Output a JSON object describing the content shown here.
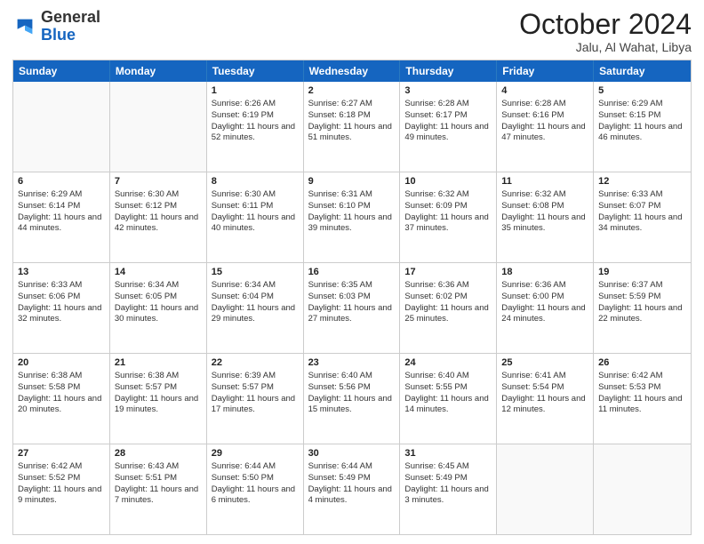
{
  "header": {
    "logo_general": "General",
    "logo_blue": "Blue",
    "month_title": "October 2024",
    "location": "Jalu, Al Wahat, Libya"
  },
  "weekdays": [
    "Sunday",
    "Monday",
    "Tuesday",
    "Wednesday",
    "Thursday",
    "Friday",
    "Saturday"
  ],
  "rows": [
    [
      {
        "day": "",
        "sunrise": "",
        "sunset": "",
        "daylight": ""
      },
      {
        "day": "",
        "sunrise": "",
        "sunset": "",
        "daylight": ""
      },
      {
        "day": "1",
        "sunrise": "Sunrise: 6:26 AM",
        "sunset": "Sunset: 6:19 PM",
        "daylight": "Daylight: 11 hours and 52 minutes."
      },
      {
        "day": "2",
        "sunrise": "Sunrise: 6:27 AM",
        "sunset": "Sunset: 6:18 PM",
        "daylight": "Daylight: 11 hours and 51 minutes."
      },
      {
        "day": "3",
        "sunrise": "Sunrise: 6:28 AM",
        "sunset": "Sunset: 6:17 PM",
        "daylight": "Daylight: 11 hours and 49 minutes."
      },
      {
        "day": "4",
        "sunrise": "Sunrise: 6:28 AM",
        "sunset": "Sunset: 6:16 PM",
        "daylight": "Daylight: 11 hours and 47 minutes."
      },
      {
        "day": "5",
        "sunrise": "Sunrise: 6:29 AM",
        "sunset": "Sunset: 6:15 PM",
        "daylight": "Daylight: 11 hours and 46 minutes."
      }
    ],
    [
      {
        "day": "6",
        "sunrise": "Sunrise: 6:29 AM",
        "sunset": "Sunset: 6:14 PM",
        "daylight": "Daylight: 11 hours and 44 minutes."
      },
      {
        "day": "7",
        "sunrise": "Sunrise: 6:30 AM",
        "sunset": "Sunset: 6:12 PM",
        "daylight": "Daylight: 11 hours and 42 minutes."
      },
      {
        "day": "8",
        "sunrise": "Sunrise: 6:30 AM",
        "sunset": "Sunset: 6:11 PM",
        "daylight": "Daylight: 11 hours and 40 minutes."
      },
      {
        "day": "9",
        "sunrise": "Sunrise: 6:31 AM",
        "sunset": "Sunset: 6:10 PM",
        "daylight": "Daylight: 11 hours and 39 minutes."
      },
      {
        "day": "10",
        "sunrise": "Sunrise: 6:32 AM",
        "sunset": "Sunset: 6:09 PM",
        "daylight": "Daylight: 11 hours and 37 minutes."
      },
      {
        "day": "11",
        "sunrise": "Sunrise: 6:32 AM",
        "sunset": "Sunset: 6:08 PM",
        "daylight": "Daylight: 11 hours and 35 minutes."
      },
      {
        "day": "12",
        "sunrise": "Sunrise: 6:33 AM",
        "sunset": "Sunset: 6:07 PM",
        "daylight": "Daylight: 11 hours and 34 minutes."
      }
    ],
    [
      {
        "day": "13",
        "sunrise": "Sunrise: 6:33 AM",
        "sunset": "Sunset: 6:06 PM",
        "daylight": "Daylight: 11 hours and 32 minutes."
      },
      {
        "day": "14",
        "sunrise": "Sunrise: 6:34 AM",
        "sunset": "Sunset: 6:05 PM",
        "daylight": "Daylight: 11 hours and 30 minutes."
      },
      {
        "day": "15",
        "sunrise": "Sunrise: 6:34 AM",
        "sunset": "Sunset: 6:04 PM",
        "daylight": "Daylight: 11 hours and 29 minutes."
      },
      {
        "day": "16",
        "sunrise": "Sunrise: 6:35 AM",
        "sunset": "Sunset: 6:03 PM",
        "daylight": "Daylight: 11 hours and 27 minutes."
      },
      {
        "day": "17",
        "sunrise": "Sunrise: 6:36 AM",
        "sunset": "Sunset: 6:02 PM",
        "daylight": "Daylight: 11 hours and 25 minutes."
      },
      {
        "day": "18",
        "sunrise": "Sunrise: 6:36 AM",
        "sunset": "Sunset: 6:00 PM",
        "daylight": "Daylight: 11 hours and 24 minutes."
      },
      {
        "day": "19",
        "sunrise": "Sunrise: 6:37 AM",
        "sunset": "Sunset: 5:59 PM",
        "daylight": "Daylight: 11 hours and 22 minutes."
      }
    ],
    [
      {
        "day": "20",
        "sunrise": "Sunrise: 6:38 AM",
        "sunset": "Sunset: 5:58 PM",
        "daylight": "Daylight: 11 hours and 20 minutes."
      },
      {
        "day": "21",
        "sunrise": "Sunrise: 6:38 AM",
        "sunset": "Sunset: 5:57 PM",
        "daylight": "Daylight: 11 hours and 19 minutes."
      },
      {
        "day": "22",
        "sunrise": "Sunrise: 6:39 AM",
        "sunset": "Sunset: 5:57 PM",
        "daylight": "Daylight: 11 hours and 17 minutes."
      },
      {
        "day": "23",
        "sunrise": "Sunrise: 6:40 AM",
        "sunset": "Sunset: 5:56 PM",
        "daylight": "Daylight: 11 hours and 15 minutes."
      },
      {
        "day": "24",
        "sunrise": "Sunrise: 6:40 AM",
        "sunset": "Sunset: 5:55 PM",
        "daylight": "Daylight: 11 hours and 14 minutes."
      },
      {
        "day": "25",
        "sunrise": "Sunrise: 6:41 AM",
        "sunset": "Sunset: 5:54 PM",
        "daylight": "Daylight: 11 hours and 12 minutes."
      },
      {
        "day": "26",
        "sunrise": "Sunrise: 6:42 AM",
        "sunset": "Sunset: 5:53 PM",
        "daylight": "Daylight: 11 hours and 11 minutes."
      }
    ],
    [
      {
        "day": "27",
        "sunrise": "Sunrise: 6:42 AM",
        "sunset": "Sunset: 5:52 PM",
        "daylight": "Daylight: 11 hours and 9 minutes."
      },
      {
        "day": "28",
        "sunrise": "Sunrise: 6:43 AM",
        "sunset": "Sunset: 5:51 PM",
        "daylight": "Daylight: 11 hours and 7 minutes."
      },
      {
        "day": "29",
        "sunrise": "Sunrise: 6:44 AM",
        "sunset": "Sunset: 5:50 PM",
        "daylight": "Daylight: 11 hours and 6 minutes."
      },
      {
        "day": "30",
        "sunrise": "Sunrise: 6:44 AM",
        "sunset": "Sunset: 5:49 PM",
        "daylight": "Daylight: 11 hours and 4 minutes."
      },
      {
        "day": "31",
        "sunrise": "Sunrise: 6:45 AM",
        "sunset": "Sunset: 5:49 PM",
        "daylight": "Daylight: 11 hours and 3 minutes."
      },
      {
        "day": "",
        "sunrise": "",
        "sunset": "",
        "daylight": ""
      },
      {
        "day": "",
        "sunrise": "",
        "sunset": "",
        "daylight": ""
      }
    ]
  ]
}
